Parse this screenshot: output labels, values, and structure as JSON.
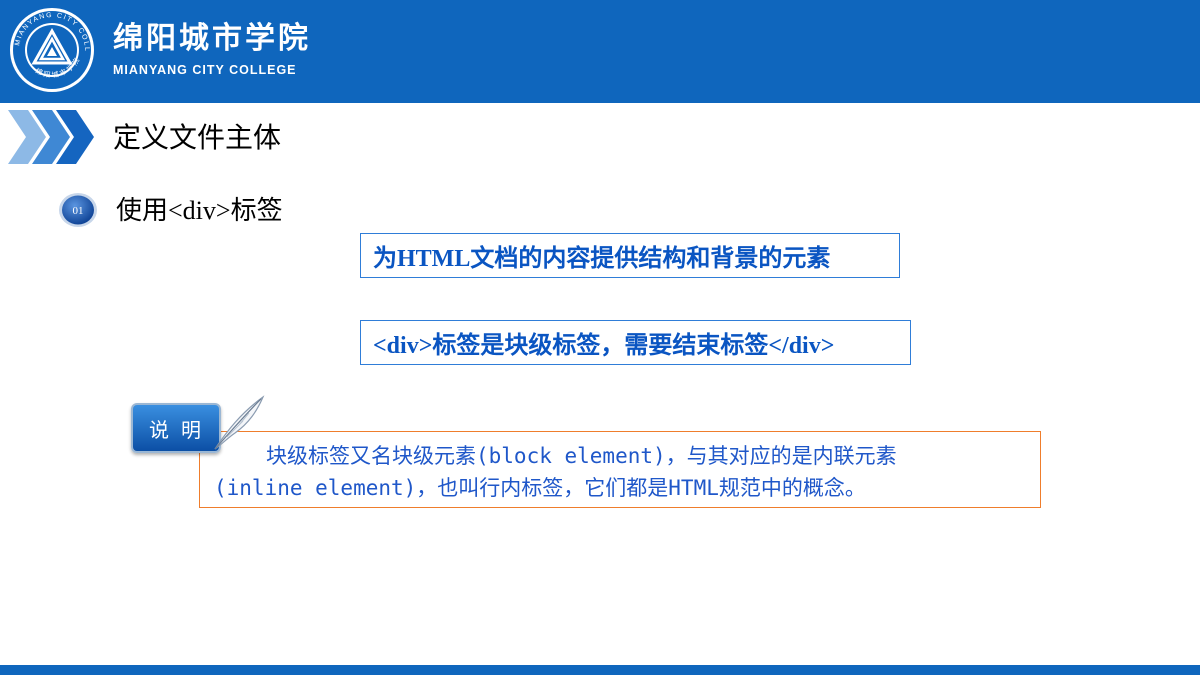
{
  "header": {
    "school_name_cn": "绵阳城市学院",
    "school_name_en": "MIANYANG CITY COLLEGE",
    "logo_ring_text": "MIANYANG CITY COLLEGE",
    "logo_ring_text_cn": "绵阳城市学院",
    "bg_color": "#0f66bd"
  },
  "section": {
    "title": "定义文件主体",
    "icon": "triple-chevron-icon"
  },
  "subsection": {
    "number": "01",
    "title_prefix": "使用",
    "title_tag": "<div>",
    "title_suffix": "标签"
  },
  "boxes": [
    {
      "text": "为HTML文档的内容提供结构和背景的元素"
    },
    {
      "text": "<div>标签是块级标签，需要结束标签</div>"
    }
  ],
  "note": {
    "label": "说明",
    "line1": "块级标签又名块级元素(block element)，与其对应的是内联元素",
    "line2": "(inline element)，也叫行内标签，它们都是HTML规范中的概念。",
    "border_color": "#ef7d2c",
    "text_color": "#1f57c9"
  }
}
